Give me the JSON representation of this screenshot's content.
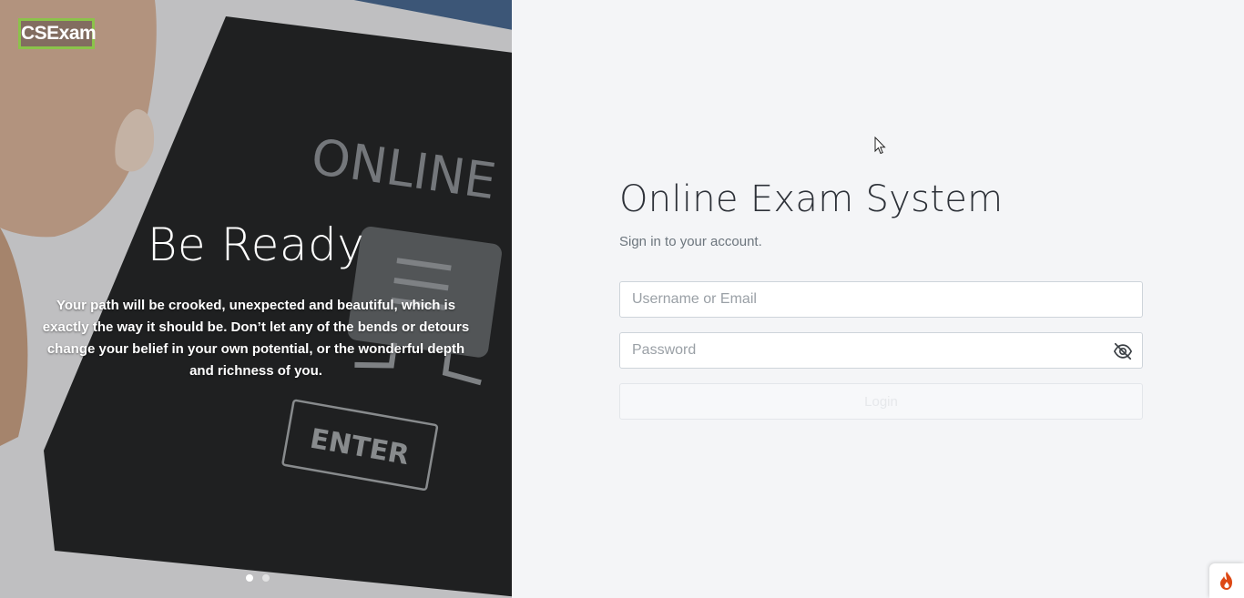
{
  "hero": {
    "logo_text": "CSExam",
    "title": "Be Ready",
    "text": "Your path will be crooked, unexpected and beautiful, which is exactly the way it should be. Don’t let any of the bends or detours change your belief in your own potential, or the wonderful depth and richness of you.",
    "image_text": {
      "screen_label": "ONLINE T",
      "button_label": "ENTER"
    },
    "carousel": {
      "slides": 2,
      "active": 0
    }
  },
  "login": {
    "title": "Online Exam System",
    "subtitle": "Sign in to your account.",
    "username_placeholder": "Username or Email",
    "password_placeholder": "Password",
    "button_label": "Login"
  },
  "icons": {
    "password_toggle": "eye-slash-icon",
    "badge": "flame-icon"
  },
  "colors": {
    "logo_border": "#8bc34a",
    "page_background": "#f4f5f7",
    "title_text": "#2d3138"
  }
}
